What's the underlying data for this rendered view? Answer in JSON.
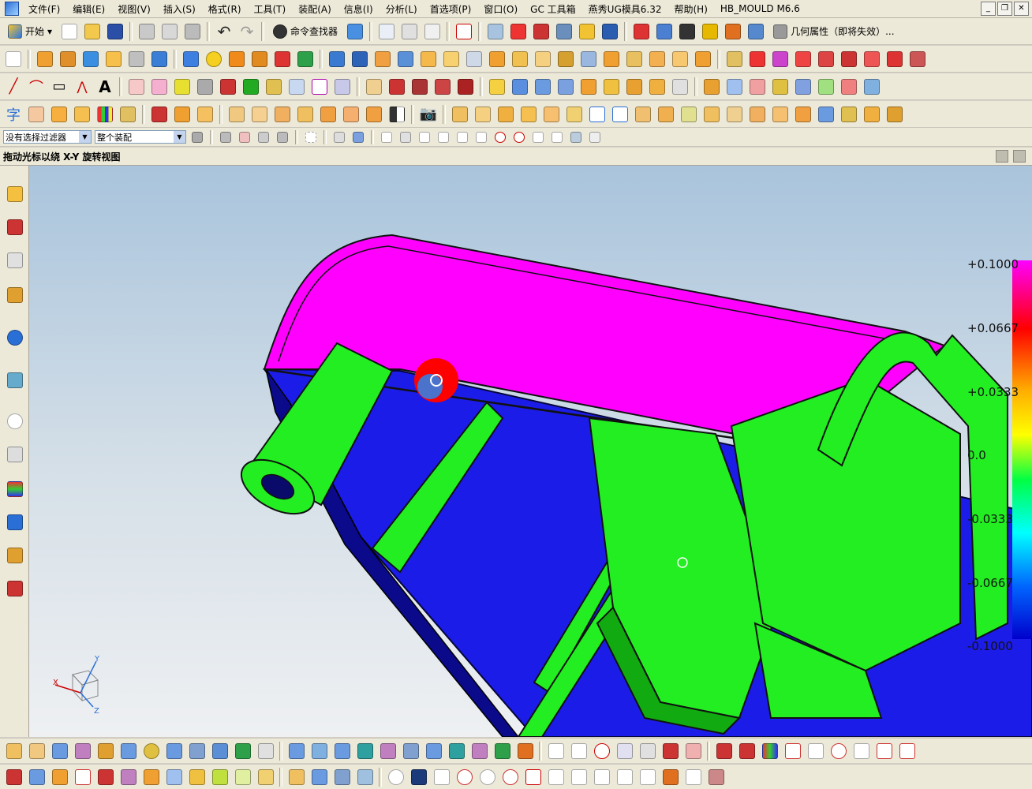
{
  "menu": [
    "文件(F)",
    "编辑(E)",
    "视图(V)",
    "插入(S)",
    "格式(R)",
    "工具(T)",
    "装配(A)",
    "信息(I)",
    "分析(L)",
    "首选项(P)",
    "窗口(O)",
    "GC 工具箱",
    "燕秀UG模具6.32",
    "帮助(H)",
    "HB_MOULD M6.6"
  ],
  "toolbar1": {
    "start_label": "开始",
    "cmd_finder_label": "命令查找器",
    "geom_props_label": "几何属性（即将失效）..."
  },
  "selection_bar": {
    "filter_value": "没有选择过滤器",
    "scope_value": "整个装配"
  },
  "status": {
    "message": "拖动光标以绕 X-Y 旋转视图"
  },
  "scale": {
    "labels": [
      "+0.1000",
      "+0.0667",
      "+0.0333",
      "0.0",
      "-0.0333",
      "-0.0667",
      "-0.1000"
    ]
  },
  "triad": {
    "x": "X",
    "y": "Y",
    "z": "Z"
  },
  "colors": {
    "surface_top": "#ff00ff",
    "rib": "#22ee22",
    "base": "#1a1aee",
    "marker": "#ff0000"
  }
}
